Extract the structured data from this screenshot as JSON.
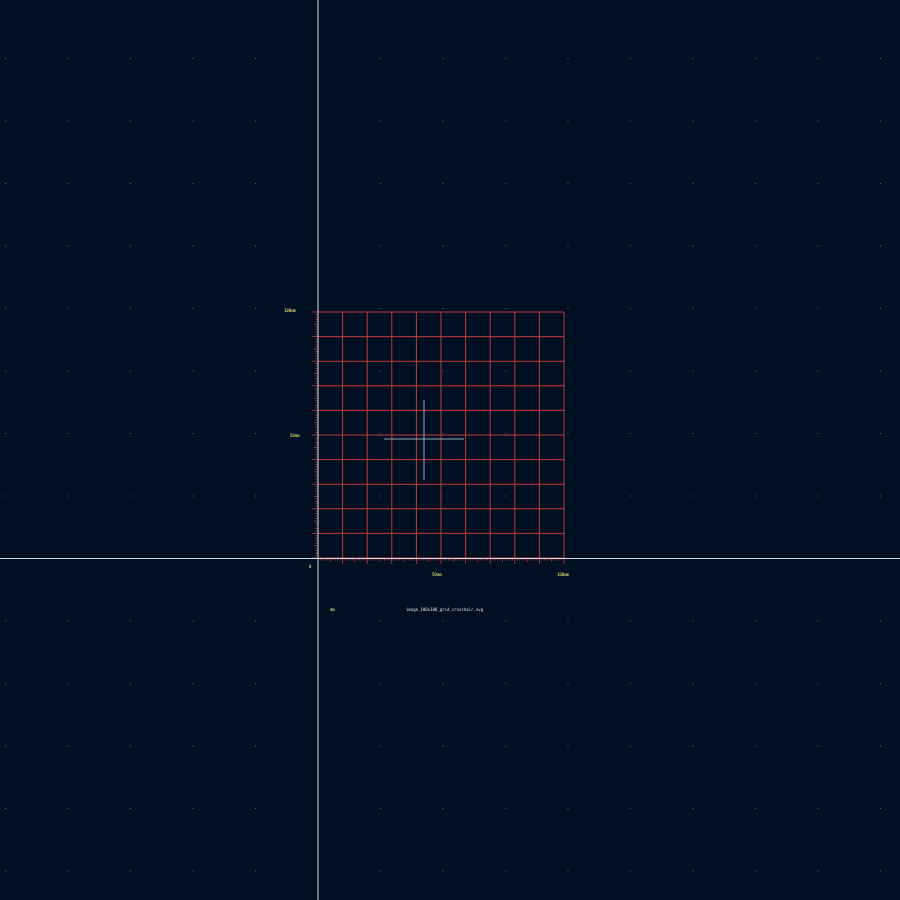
{
  "canvas": {
    "background_color": "#010f22",
    "grid_dot_color": "#5a6a80",
    "origin_axis_color": "#d8dce4",
    "grid_line_color": "#c03a3a",
    "crosshair_color": "#9aa6b4",
    "label_color": "#ffff88"
  },
  "ruler": {
    "x_labels": [
      "0",
      "50mm",
      "100mm"
    ],
    "y_labels": [
      "0",
      "50mm",
      "100mm"
    ]
  },
  "status": {
    "units": "mm",
    "file_info": "image_100x100_grid_crosshair.svg"
  }
}
